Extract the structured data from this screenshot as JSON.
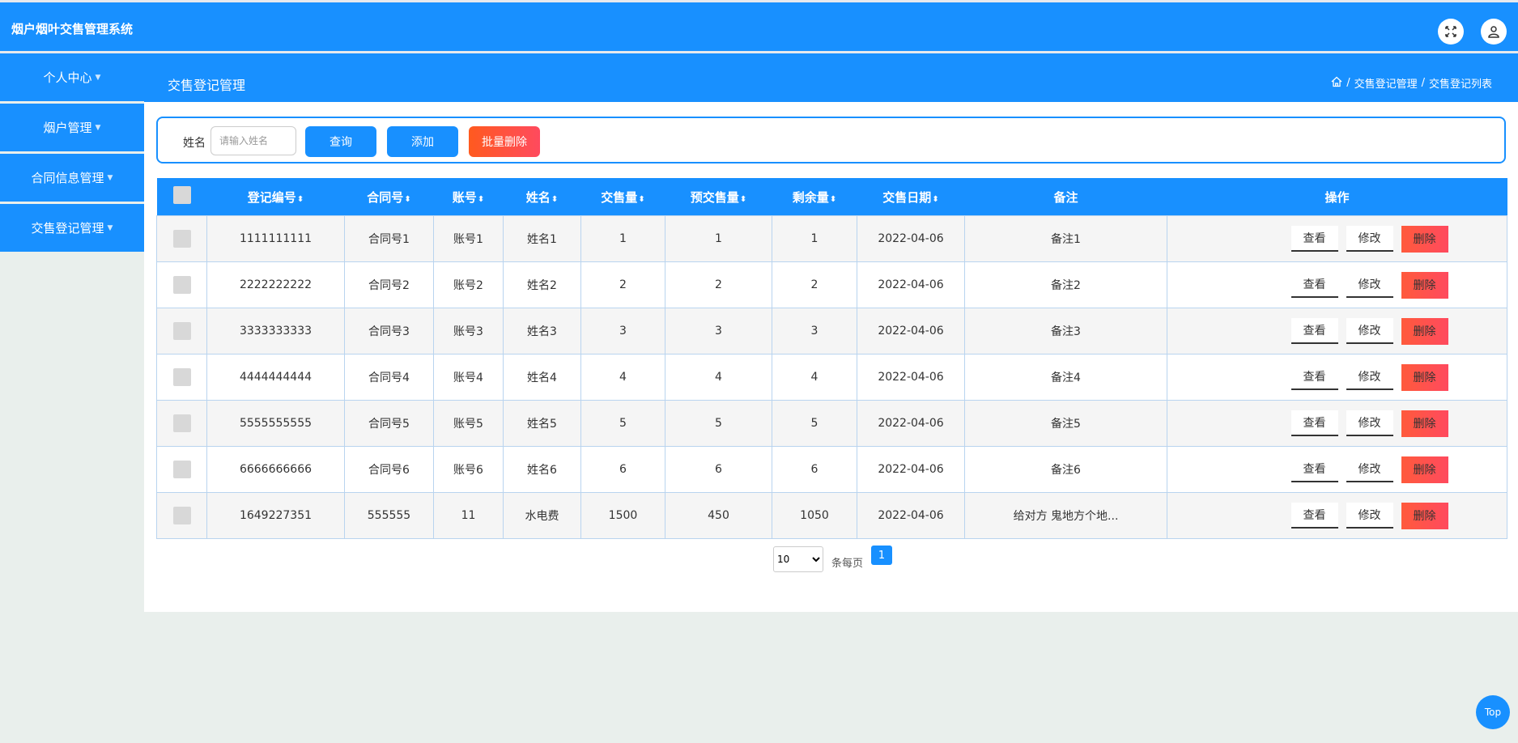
{
  "app": {
    "title": "烟户烟叶交售管理系统"
  },
  "sidebar": {
    "items": [
      {
        "label": "个人中心"
      },
      {
        "label": "烟户管理"
      },
      {
        "label": "合同信息管理"
      },
      {
        "label": "交售登记管理"
      }
    ]
  },
  "header": {
    "title": "交售登记管理",
    "breadcrumb": [
      "交售登记管理",
      "交售登记列表"
    ],
    "separator": "/"
  },
  "search": {
    "label": "姓名",
    "placeholder": "请输入姓名",
    "query_label": "查询",
    "add_label": "添加",
    "batch_delete_label": "批量删除"
  },
  "table": {
    "columns": [
      "登记编号",
      "合同号",
      "账号",
      "姓名",
      "交售量",
      "预交售量",
      "剩余量",
      "交售日期",
      "备注",
      "操作"
    ],
    "actions": {
      "view": "查看",
      "edit": "修改",
      "delete": "删除"
    },
    "rows": [
      [
        "1111111111",
        "合同号1",
        "账号1",
        "姓名1",
        "1",
        "1",
        "1",
        "2022-04-06",
        "备注1"
      ],
      [
        "2222222222",
        "合同号2",
        "账号2",
        "姓名2",
        "2",
        "2",
        "2",
        "2022-04-06",
        "备注2"
      ],
      [
        "3333333333",
        "合同号3",
        "账号3",
        "姓名3",
        "3",
        "3",
        "3",
        "2022-04-06",
        "备注3"
      ],
      [
        "4444444444",
        "合同号4",
        "账号4",
        "姓名4",
        "4",
        "4",
        "4",
        "2022-04-06",
        "备注4"
      ],
      [
        "5555555555",
        "合同号5",
        "账号5",
        "姓名5",
        "5",
        "5",
        "5",
        "2022-04-06",
        "备注5"
      ],
      [
        "6666666666",
        "合同号6",
        "账号6",
        "姓名6",
        "6",
        "6",
        "6",
        "2022-04-06",
        "备注6"
      ],
      [
        "1649227351",
        "555555",
        "11",
        "水电费",
        "1500",
        "450",
        "1050",
        "2022-04-06",
        "给对方 鬼地方个地..."
      ]
    ]
  },
  "pagination": {
    "page_size": "10",
    "per_page_label": "条每页",
    "current_page": "1"
  },
  "top_button": "Top",
  "colors": {
    "primary": "#1890ff",
    "danger": "#ff4a5e",
    "background": "#e9efec"
  }
}
